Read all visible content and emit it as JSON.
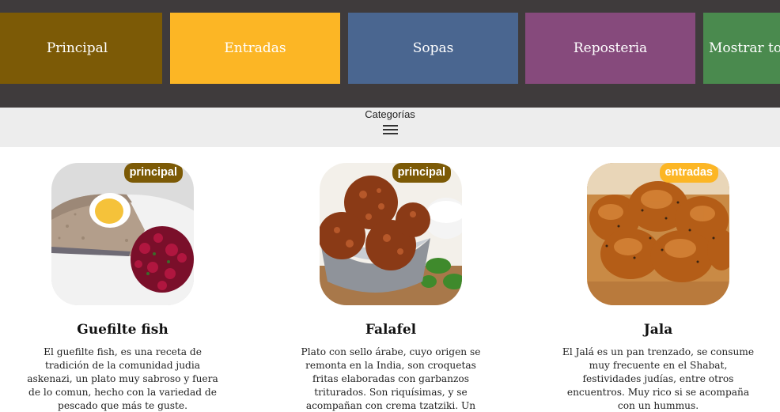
{
  "categories": [
    {
      "label": "Principal",
      "color": "#7c5a06"
    },
    {
      "label": "Entradas",
      "color": "#fcb625"
    },
    {
      "label": "Sopas",
      "color": "#4a6690"
    },
    {
      "label": "Reposteria",
      "color": "#864a7c"
    },
    {
      "label": "Mostrar todo",
      "color": "#4a8a4e"
    }
  ],
  "category_menu": {
    "title": "Categorías",
    "icon": "hamburger-menu-icon"
  },
  "dishes": [
    {
      "name": "Guefilte fish",
      "badge": "principal",
      "badge_color": "#7c5a06",
      "description": "El guefilte fish, es una receta de tradición de la comunidad judia askenazi, un plato muy sabroso y fuera de lo comun, hecho con la variedad de pescado que más te guste."
    },
    {
      "name": "Falafel",
      "badge": "principal",
      "badge_color": "#7c5a06",
      "description": "Plato con sello árabe, cuyo origen se remonta en la India, son croquetas fritas elaboradas con garbanzos triturados. Son riquísimas, y se acompañan con crema tzatziki. Un perfecto y nutritivo entrante."
    },
    {
      "name": "Jala",
      "badge": "entradas",
      "badge_color": "#fcb625",
      "description": "El Jalá es un pan trenzado, se consume muy frecuente en el Shabat, festividades judías, entre otros encuentros. Muy rico si se acompaña con un hummus."
    }
  ]
}
